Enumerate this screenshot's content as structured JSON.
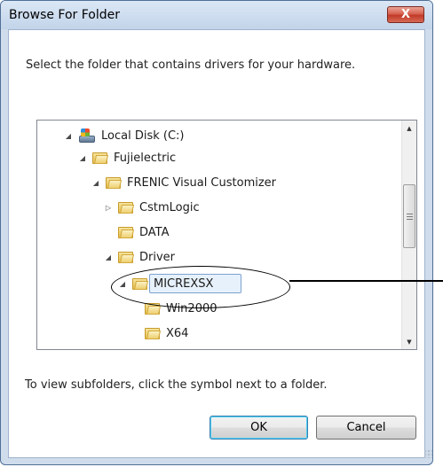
{
  "dialog": {
    "title": "Browse For Folder",
    "close_label": "X",
    "instruction": "Select the folder that contains drivers for your hardware.",
    "hint": "To view subfolders, click the symbol next to a folder.",
    "ok_label": "OK",
    "cancel_label": "Cancel"
  },
  "tree": {
    "items": [
      {
        "label": "Local Disk (C:)",
        "icon": "drive-icon",
        "expander": "expanded"
      },
      {
        "label": "Fujielectric",
        "icon": "folder-icon",
        "expander": "expanded"
      },
      {
        "label": "FRENIC Visual Customizer",
        "icon": "folder-icon",
        "expander": "expanded"
      },
      {
        "label": "CstmLogic",
        "icon": "folder-icon",
        "expander": "collapsed"
      },
      {
        "label": "DATA",
        "icon": "folder-icon",
        "expander": "none"
      },
      {
        "label": "Driver",
        "icon": "folder-icon",
        "expander": "expanded"
      },
      {
        "label": "MICREXSX",
        "icon": "folder-icon",
        "expander": "expanded",
        "selected": true
      },
      {
        "label": "Win2000",
        "icon": "folder-icon",
        "expander": "none"
      },
      {
        "label": "X64",
        "icon": "folder-icon",
        "expander": "none"
      }
    ]
  },
  "colors": {
    "frame": "#cfdcec",
    "close_button": "#c23a28",
    "selection": "#e7f1fb"
  }
}
